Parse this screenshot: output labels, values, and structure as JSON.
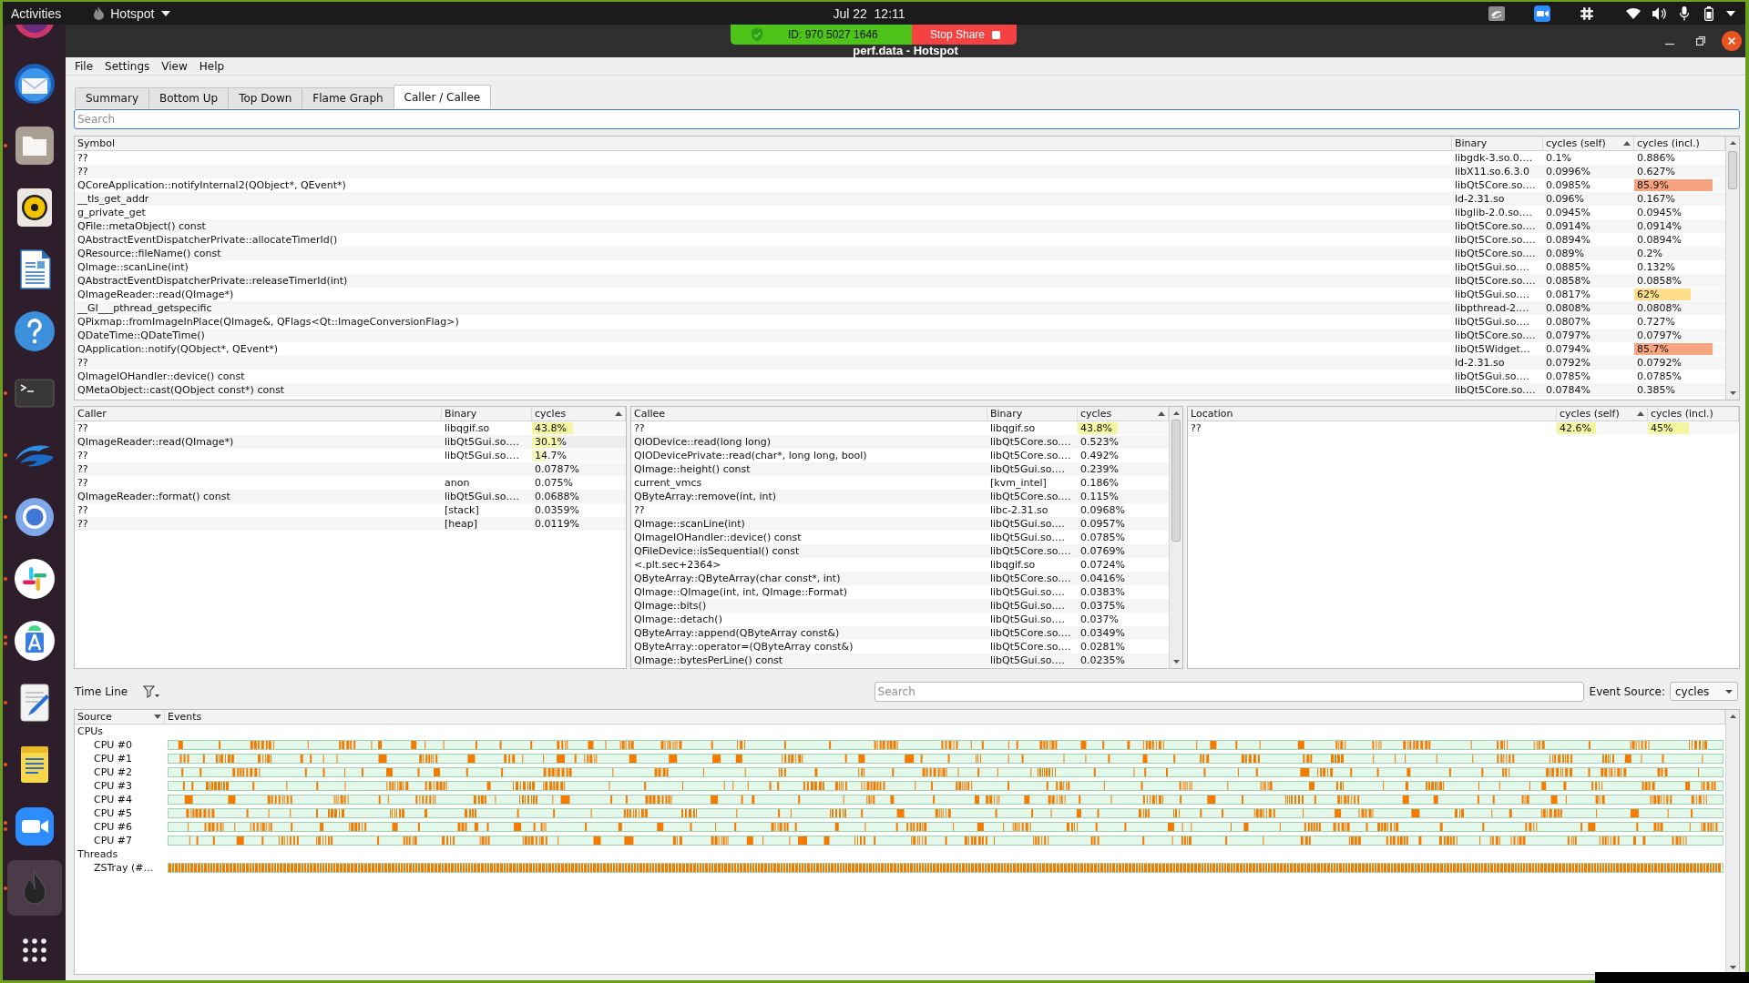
{
  "top_bar": {
    "activities": "Activities",
    "app_menu": "Hotspot",
    "clock": "Jul 22  12:11",
    "tray": [
      {
        "kind": "share"
      },
      {
        "kind": "video"
      },
      {
        "kind": "hash"
      },
      {
        "kind": "wifi"
      },
      {
        "kind": "volume"
      },
      {
        "kind": "mic"
      },
      {
        "kind": "battery"
      },
      {
        "kind": "menu"
      }
    ]
  },
  "dock": {
    "items": [
      {
        "kind": "round",
        "active": false,
        "running": false
      },
      {
        "kind": "mail",
        "active": false,
        "running": false
      },
      {
        "kind": "files",
        "active": false,
        "running": true,
        "multiple": false
      },
      {
        "kind": "music",
        "active": false,
        "running": false
      },
      {
        "kind": "writer",
        "active": false,
        "running": false
      },
      {
        "kind": "help",
        "active": false,
        "running": false
      },
      {
        "kind": "terminal",
        "active": false,
        "running": true,
        "multiple": false
      },
      {
        "kind": "cloud",
        "active": false,
        "running": true,
        "multiple": false
      },
      {
        "kind": "browser",
        "active": false,
        "running": true,
        "multiple": false
      },
      {
        "kind": "chat",
        "active": false,
        "running": true,
        "multiple": false
      },
      {
        "kind": "studio",
        "active": false,
        "running": true,
        "multiple": true
      },
      {
        "kind": "editor",
        "active": false,
        "running": true,
        "multiple": false
      },
      {
        "kind": "notes",
        "active": false,
        "running": true,
        "multiple": false
      },
      {
        "kind": "video",
        "active": false,
        "running": true,
        "multiple": true
      },
      {
        "kind": "profiler",
        "active": true,
        "running": true,
        "multiple": false
      },
      {
        "kind": "grid",
        "active": false,
        "running": false
      }
    ]
  },
  "window": {
    "title": "perf.data - Hotspot"
  },
  "share_bar": {
    "meeting_id": "ID: 970 5027 1646",
    "stop": "Stop Share"
  },
  "menu": [
    "File",
    "Settings",
    "View",
    "Help"
  ],
  "tabs": [
    {
      "label": "Summary",
      "selected": false
    },
    {
      "label": "Bottom Up",
      "selected": false
    },
    {
      "label": "Top Down",
      "selected": false
    },
    {
      "label": "Flame Graph",
      "selected": false
    },
    {
      "label": "Caller / Callee",
      "selected": true
    }
  ],
  "search": {
    "placeholder": "Search"
  },
  "symbol_table": {
    "columns": [
      {
        "label": "Symbol",
        "sorted": false
      },
      {
        "label": "Binary",
        "sorted": false
      },
      {
        "label": "cycles (self)",
        "sorted": true,
        "descending": false
      },
      {
        "label": "cycles (incl.)",
        "sorted": false
      }
    ],
    "rows": [
      {
        "symbol": "??",
        "binary": "libgdk-3.so.0.…",
        "self": {
          "text": "0.1%"
        },
        "incl": {
          "text": "0.886%"
        }
      },
      {
        "symbol": "??",
        "binary": "libX11.so.6.3.0",
        "self": {
          "text": "0.0996%"
        },
        "incl": {
          "text": "0.627%"
        }
      },
      {
        "symbol": "QCoreApplication::notifyInternal2(QObject*, QEvent*)",
        "binary": "libQt5Core.so.…",
        "self": {
          "text": "0.0985%"
        },
        "incl": {
          "text": "85.9%",
          "level": 0.859
        }
      },
      {
        "symbol": "__tls_get_addr",
        "binary": "ld-2.31.so",
        "self": {
          "text": "0.096%"
        },
        "incl": {
          "text": "0.167%"
        }
      },
      {
        "symbol": "g_private_get",
        "binary": "libglib-2.0.so.…",
        "self": {
          "text": "0.0945%"
        },
        "incl": {
          "text": "0.0945%"
        }
      },
      {
        "symbol": "QFile::metaObject() const",
        "binary": "libQt5Core.so.…",
        "self": {
          "text": "0.0914%"
        },
        "incl": {
          "text": "0.0914%"
        }
      },
      {
        "symbol": "QAbstractEventDispatcherPrivate::allocateTimerId()",
        "binary": "libQt5Core.so.…",
        "self": {
          "text": "0.0894%"
        },
        "incl": {
          "text": "0.0894%"
        }
      },
      {
        "symbol": "QResource::fileName() const",
        "binary": "libQt5Core.so.…",
        "self": {
          "text": "0.089%"
        },
        "incl": {
          "text": "0.2%"
        }
      },
      {
        "symbol": "QImage::scanLine(int)",
        "binary": "libQt5Gui.so.…",
        "self": {
          "text": "0.0885%"
        },
        "incl": {
          "text": "0.132%"
        }
      },
      {
        "symbol": "QAbstractEventDispatcherPrivate::releaseTimerId(int)",
        "binary": "libQt5Core.so.…",
        "self": {
          "text": "0.0858%"
        },
        "incl": {
          "text": "0.0858%"
        }
      },
      {
        "symbol": "QImageReader::read(QImage*)",
        "binary": "libQt5Gui.so.…",
        "self": {
          "text": "0.0817%"
        },
        "incl": {
          "text": "62%",
          "level": 0.62
        }
      },
      {
        "symbol": "__GI___pthread_getspecific",
        "binary": "libpthread-2.…",
        "self": {
          "text": "0.0808%"
        },
        "incl": {
          "text": "0.0808%"
        }
      },
      {
        "symbol": "QPixmap::fromImageInPlace(QImage&, QFlags<Qt::ImageConversionFlag>)",
        "binary": "libQt5Gui.so.…",
        "self": {
          "text": "0.0807%"
        },
        "incl": {
          "text": "0.727%"
        }
      },
      {
        "symbol": "QDateTime::QDateTime()",
        "binary": "libQt5Core.so.…",
        "self": {
          "text": "0.0797%"
        },
        "incl": {
          "text": "0.0797%"
        }
      },
      {
        "symbol": "QApplication::notify(QObject*, QEvent*)",
        "binary": "libQt5Widget…",
        "self": {
          "text": "0.0794%"
        },
        "incl": {
          "text": "85.7%",
          "level": 0.857
        }
      },
      {
        "symbol": "??",
        "binary": "ld-2.31.so",
        "self": {
          "text": "0.0792%"
        },
        "incl": {
          "text": "0.0792%"
        }
      },
      {
        "symbol": "QImageIOHandler::device() const",
        "binary": "libQt5Gui.so.…",
        "self": {
          "text": "0.0785%"
        },
        "incl": {
          "text": "0.0785%"
        }
      },
      {
        "symbol": "QMetaObject::cast(QObject const*) const",
        "binary": "libQt5Core.so.…",
        "self": {
          "text": "0.0784%"
        },
        "incl": {
          "text": "0.385%"
        }
      }
    ]
  },
  "caller_table": {
    "columns": [
      {
        "label": "Caller",
        "sorted": false
      },
      {
        "label": "Binary",
        "sorted": false
      },
      {
        "label": "cycles",
        "sorted": true,
        "descending": false
      }
    ],
    "rows": [
      {
        "caller": "??",
        "binary": "libqgif.so",
        "cycles": {
          "text": "43.8%",
          "level": 0.438
        }
      },
      {
        "caller": "QImageReader::read(QImage*)",
        "binary": "libQt5Gui.so.…",
        "cycles": {
          "text": "30.1%",
          "level": 0.301
        }
      },
      {
        "caller": "??",
        "binary": "libQt5Gui.so.…",
        "cycles": {
          "text": "14.7%",
          "level": 0.147
        }
      },
      {
        "caller": "??",
        "cycles": {
          "text": "0.0787%"
        }
      },
      {
        "caller": "??",
        "binary": "anon",
        "cycles": {
          "text": "0.075%"
        }
      },
      {
        "caller": "QImageReader::format() const",
        "binary": "libQt5Gui.so.…",
        "cycles": {
          "text": "0.0688%"
        }
      },
      {
        "caller": "??",
        "binary": "[stack]",
        "cycles": {
          "text": "0.0359%"
        }
      },
      {
        "caller": "??",
        "binary": "[heap]",
        "cycles": {
          "text": "0.0119%"
        }
      }
    ]
  },
  "callee_table": {
    "columns": [
      {
        "label": "Callee",
        "sorted": false
      },
      {
        "label": "Binary",
        "sorted": false
      },
      {
        "label": "cycles",
        "sorted": true,
        "descending": false
      }
    ],
    "rows": [
      {
        "callee": "??",
        "binary": "libqgif.so",
        "cycles": {
          "text": "43.8%",
          "level": 0.438
        }
      },
      {
        "callee": "QIODevice::read(long long)",
        "binary": "libQt5Core.so.…",
        "cycles": {
          "text": "0.523%"
        }
      },
      {
        "callee": "QIODevicePrivate::read(char*, long long, bool)",
        "binary": "libQt5Core.so.…",
        "cycles": {
          "text": "0.492%"
        }
      },
      {
        "callee": "QImage::height() const",
        "binary": "libQt5Gui.so.…",
        "cycles": {
          "text": "0.239%"
        }
      },
      {
        "callee": "current_vmcs",
        "binary": "[kvm_intel]",
        "cycles": {
          "text": "0.186%"
        }
      },
      {
        "callee": "QByteArray::remove(int, int)",
        "binary": "libQt5Core.so.…",
        "cycles": {
          "text": "0.115%"
        }
      },
      {
        "callee": "??",
        "binary": "libc-2.31.so",
        "cycles": {
          "text": "0.0968%"
        }
      },
      {
        "callee": "QImage::scanLine(int)",
        "binary": "libQt5Gui.so.…",
        "cycles": {
          "text": "0.0957%"
        }
      },
      {
        "callee": "QImageIOHandler::device() const",
        "binary": "libQt5Gui.so.…",
        "cycles": {
          "text": "0.0785%"
        }
      },
      {
        "callee": "QFileDevice::isSequential() const",
        "binary": "libQt5Core.so.…",
        "cycles": {
          "text": "0.0769%"
        }
      },
      {
        "callee": "<.plt.sec+2364>",
        "binary": "libqgif.so",
        "cycles": {
          "text": "0.0724%"
        }
      },
      {
        "callee": "QByteArray::QByteArray(char const*, int)",
        "binary": "libQt5Core.so.…",
        "cycles": {
          "text": "0.0416%"
        }
      },
      {
        "callee": "QImage::QImage(int, int, QImage::Format)",
        "binary": "libQt5Gui.so.…",
        "cycles": {
          "text": "0.0383%"
        }
      },
      {
        "callee": "QImage::bits()",
        "binary": "libQt5Gui.so.…",
        "cycles": {
          "text": "0.0375%"
        }
      },
      {
        "callee": "QImage::detach()",
        "binary": "libQt5Gui.so.…",
        "cycles": {
          "text": "0.037%"
        }
      },
      {
        "callee": "QByteArray::append(QByteArray const&)",
        "binary": "libQt5Core.so.…",
        "cycles": {
          "text": "0.0349%"
        }
      },
      {
        "callee": "QByteArray::operator=(QByteArray const&)",
        "binary": "libQt5Core.so.…",
        "cycles": {
          "text": "0.0281%"
        }
      },
      {
        "callee": "QImage::bytesPerLine() const",
        "binary": "libQt5Gui.so.…",
        "cycles": {
          "text": "0.0235%"
        }
      }
    ]
  },
  "location_table": {
    "columns": [
      {
        "label": "Location",
        "sorted": false
      },
      {
        "label": "cycles (self)",
        "sorted": true,
        "descending": false
      },
      {
        "label": "cycles (incl.)",
        "sorted": false
      }
    ],
    "rows": [
      {
        "location": "??",
        "self": {
          "text": "42.6%",
          "level": 0.426
        },
        "incl": {
          "text": "45%",
          "level": 0.45
        }
      }
    ]
  },
  "timeline": {
    "label": "Time Line",
    "search": {
      "placeholder": "Search"
    },
    "event_source": {
      "label": "Event Source:",
      "value": "cycles"
    },
    "columns": [
      {
        "label": "Source",
        "sorted": true,
        "descending": true
      },
      {
        "label": "Events",
        "sorted": false
      }
    ],
    "rows": [
      {
        "label": "CPUs",
        "children": [
          {
            "label": "CPU #0",
            "kind": "cpu"
          },
          {
            "label": "CPU #1",
            "kind": "cpu"
          },
          {
            "label": "CPU #2",
            "kind": "cpu"
          },
          {
            "label": "CPU #3",
            "kind": "cpu"
          },
          {
            "label": "CPU #4",
            "kind": "cpu"
          },
          {
            "label": "CPU #5",
            "kind": "cpu"
          },
          {
            "label": "CPU #6",
            "kind": "cpu"
          },
          {
            "label": "CPU #7",
            "kind": "cpu"
          }
        ]
      },
      {
        "label": "Threads",
        "children": [
          {
            "label": "ZSTray (#…",
            "kind": "thread"
          }
        ]
      }
    ]
  }
}
